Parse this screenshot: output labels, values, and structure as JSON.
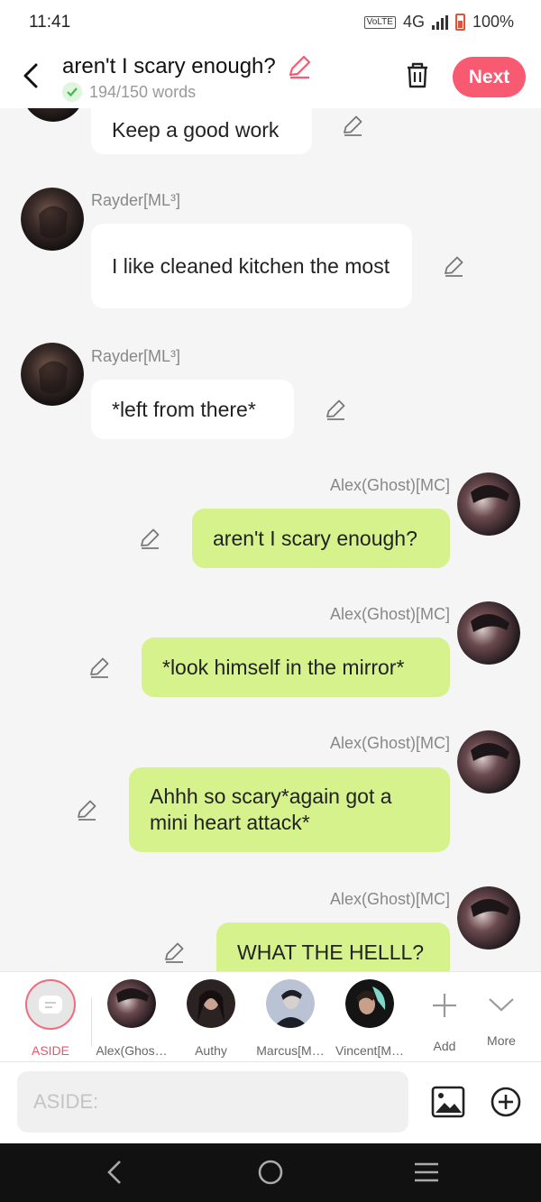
{
  "status": {
    "time": "11:41",
    "network": "4G",
    "volte": "VoLTE",
    "battery": "100%"
  },
  "header": {
    "title": "aren't I scary enough?",
    "word_count": "194/150 words",
    "next_label": "Next"
  },
  "messages": [
    {
      "side": "left",
      "text": "Keep a good work"
    },
    {
      "side": "left",
      "name": "Rayder[ML³]",
      "text": "I like cleaned kitchen the most"
    },
    {
      "side": "left",
      "name": "Rayder[ML³]",
      "text": "*left from there*"
    },
    {
      "side": "right",
      "name": "Alex(Ghost)[MC]",
      "text": "aren't I scary enough?"
    },
    {
      "side": "right",
      "name": "Alex(Ghost)[MC]",
      "text": "*look himself in the mirror*"
    },
    {
      "side": "right",
      "name": "Alex(Ghost)[MC]",
      "text": "Ahhh so scary*again got a mini heart attack*"
    },
    {
      "side": "right",
      "name": "Alex(Ghost)[MC]",
      "text": "WHAT THE HELLL?"
    }
  ],
  "characters": {
    "aside": "ASIDE",
    "alex": "Alex(Ghos…",
    "authy": "Authy",
    "marcus": "Marcus[M…",
    "vincent": "Vincent[M…",
    "add": "Add",
    "more": "More"
  },
  "input": {
    "placeholder": "ASIDE:"
  },
  "colors": {
    "accent": "#f75a71",
    "bubble_right": "#d6f28c",
    "bubble_left": "#ffffff",
    "check": "#3dbb4a"
  }
}
